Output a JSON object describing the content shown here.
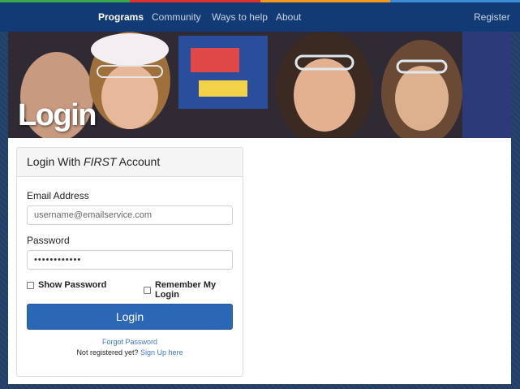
{
  "colors": {
    "stripe": [
      "#3aa84a",
      "#d9322e",
      "#f39a1e",
      "#3e8bd6"
    ],
    "nav_bg": "#123a74",
    "primary_button": "#2b67b5",
    "link": "#3a78c4"
  },
  "nav": {
    "items": [
      {
        "label": "Programs",
        "active": true
      },
      {
        "label": "Community",
        "active": false
      },
      {
        "label": "Ways to help",
        "active": false
      },
      {
        "label": "About",
        "active": false
      }
    ],
    "register_label": "Register"
  },
  "banner": {
    "title": "Login"
  },
  "login_card": {
    "header_prefix": "Login With ",
    "header_emphasis": "FIRST",
    "header_suffix": " Account",
    "email_label": "Email Address",
    "email_placeholder": "username@emailservice.com",
    "password_label": "Password",
    "password_value": "••••••••••••",
    "show_password_label": "Show Password",
    "remember_label": "Remember My Login",
    "login_button": "Login",
    "forgot_password": "Forgot Password",
    "not_registered": "Not registered yet?",
    "sign_up": "Sign Up here"
  }
}
